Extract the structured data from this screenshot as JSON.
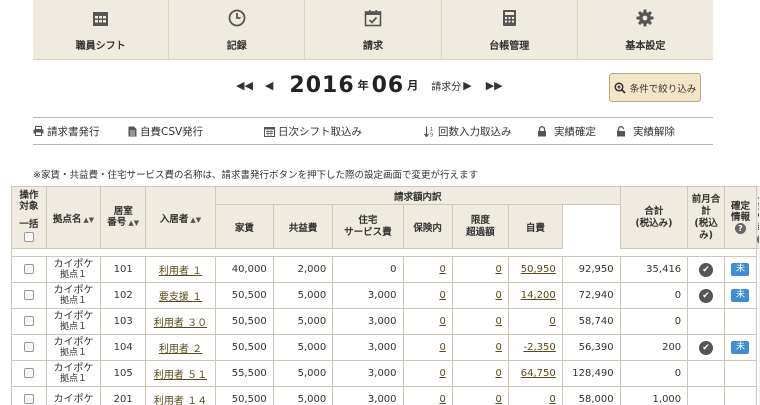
{
  "nav": [
    {
      "label": "職員シフト",
      "icon": "calendar-grid-icon"
    },
    {
      "label": "記録",
      "icon": "clock-icon"
    },
    {
      "label": "請求",
      "icon": "calendar-check-icon"
    },
    {
      "label": "台帳管理",
      "icon": "calculator-icon"
    },
    {
      "label": "基本設定",
      "icon": "gear-icon"
    }
  ],
  "period": {
    "first_arrow": "◀◀",
    "prev_arrow": "◀",
    "year": "2016",
    "year_unit": "年",
    "month": "06",
    "month_unit": "月",
    "kind": "請求分",
    "next_arrow": "▶",
    "last_arrow": "▶▶"
  },
  "filter_button": "条件で絞り込み",
  "actions": [
    {
      "label": "請求書発行",
      "icon": "printer-icon"
    },
    {
      "label": "自費CSV発行",
      "icon": "document-icon"
    },
    {
      "label": "日次シフト取込み",
      "icon": "calendar-icon"
    },
    {
      "label": "回数入力取込み",
      "icon": "sort-number-icon"
    },
    {
      "label": "実績確定",
      "icon": "lock-icon"
    },
    {
      "label": "実績解除",
      "icon": "unlock-icon"
    }
  ],
  "note": "※家賃・共益費・住宅サービス費の名称は、請求書発行ボタンを押下した際の設定画面で変更が行えます",
  "table": {
    "headers": {
      "op_line1": "操作",
      "op_line2": "対象",
      "op_line3": "一括",
      "location": "拠点名",
      "room_line1": "居室",
      "room_line2": "番号",
      "resident": "入居者",
      "group": "請求額内訳",
      "rent": "家賃",
      "common": "共益費",
      "housing_line1": "住宅",
      "housing_line2": "サービス費",
      "insurance": "保険内",
      "limit_line1": "限度",
      "limit_line2": "超過額",
      "self": "自費",
      "total_line1": "合計",
      "total_line2": "(税込み)",
      "prev_line1": "前月合計",
      "prev_line2": "(税込み)",
      "confirm_line1": "確定",
      "confirm_line2": "情報",
      "payment_line1": "入金",
      "payment_line2": "情報",
      "help": "?"
    },
    "rows": [
      {
        "loc1": "カイポケ",
        "loc2": "拠点１",
        "room": "101",
        "resident": "利用者 １",
        "rent": "40,000",
        "common": "2,000",
        "housing": "0",
        "insurance": "0",
        "limit": "0",
        "self": "50,950",
        "total": "92,950",
        "prev": "35,416",
        "confirmed": true,
        "payment": "未"
      },
      {
        "loc1": "カイポケ",
        "loc2": "拠点１",
        "room": "102",
        "resident": "要支援 １",
        "rent": "50,500",
        "common": "5,000",
        "housing": "3,000",
        "insurance": "0",
        "limit": "0",
        "self": "14,200",
        "total": "72,940",
        "prev": "0",
        "confirmed": true,
        "payment": "未"
      },
      {
        "loc1": "カイポケ",
        "loc2": "拠点１",
        "room": "103",
        "resident": "利用者 ３０",
        "rent": "50,500",
        "common": "5,000",
        "housing": "3,000",
        "insurance": "0",
        "limit": "0",
        "self": "0",
        "total": "58,740",
        "prev": "0",
        "confirmed": false,
        "payment": ""
      },
      {
        "loc1": "カイポケ",
        "loc2": "拠点１",
        "room": "104",
        "resident": "利用者 ２",
        "rent": "50,500",
        "common": "5,000",
        "housing": "3,000",
        "insurance": "0",
        "limit": "0",
        "self": "-2,350",
        "total": "56,390",
        "prev": "200",
        "confirmed": true,
        "payment": "未"
      },
      {
        "loc1": "カイポケ",
        "loc2": "拠点１",
        "room": "105",
        "resident": "利用者 ５１",
        "rent": "55,500",
        "common": "5,000",
        "housing": "3,000",
        "insurance": "0",
        "limit": "0",
        "self": "64,750",
        "total": "128,490",
        "prev": "0",
        "confirmed": false,
        "payment": ""
      },
      {
        "loc1": "カイポケ",
        "loc2": "",
        "room": "201",
        "resident": "利用者 １４",
        "rent": "50,500",
        "common": "5,000",
        "housing": "3,000",
        "insurance": "0",
        "limit": "0",
        "self": "0",
        "total": "58,000",
        "prev": "1,000",
        "confirmed": false,
        "payment": ""
      }
    ]
  }
}
